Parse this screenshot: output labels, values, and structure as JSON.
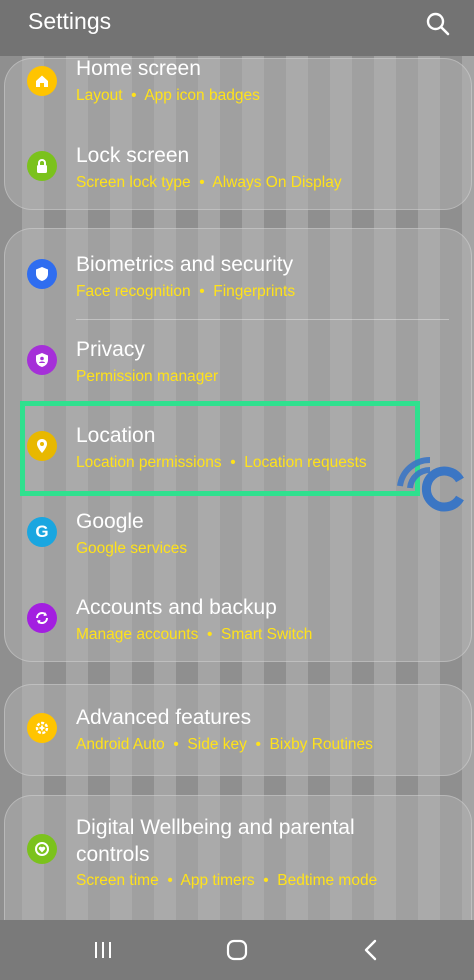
{
  "header": {
    "title": "Settings",
    "search_icon": "search-icon"
  },
  "colors": {
    "subtitle": "#ffe21a",
    "highlight": "#2fe08e"
  },
  "groups": [
    [
      {
        "label": "Home screen",
        "subs": [
          "Layout",
          "App icon badges"
        ],
        "icon": "home-icon",
        "color": "#ffc400"
      },
      {
        "label": "Lock screen",
        "subs": [
          "Screen lock type",
          "Always On Display"
        ],
        "icon": "lock-icon",
        "color": "#7bc21c"
      }
    ],
    [
      {
        "label": "Biometrics and security",
        "subs": [
          "Face recognition",
          "Fingerprints"
        ],
        "icon": "shield-icon",
        "color": "#2f6df0"
      },
      {
        "label": "Privacy",
        "subs": [
          "Permission manager"
        ],
        "icon": "privacy-icon",
        "color": "#a530d8"
      },
      {
        "label": "Location",
        "subs": [
          "Location permissions",
          "Location requests"
        ],
        "icon": "location-pin-icon",
        "color": "#e8b800"
      },
      {
        "label": "Google",
        "subs": [
          "Google services"
        ],
        "icon": "google-icon",
        "color": "#1aa6e0"
      },
      {
        "label": "Accounts and backup",
        "subs": [
          "Manage accounts",
          "Smart Switch"
        ],
        "icon": "sync-icon",
        "color": "#a31fe0"
      }
    ],
    [
      {
        "label": "Advanced features",
        "subs": [
          "Android Auto",
          "Side key",
          "Bixby Routines"
        ],
        "icon": "gear-plus-icon",
        "color": "#ffc400"
      }
    ],
    [
      {
        "label": "Digital Wellbeing and parental controls",
        "subs": [
          "Screen time",
          "App timers",
          "Bedtime mode"
        ],
        "icon": "wellbeing-icon",
        "color": "#7bc21c"
      }
    ]
  ],
  "navbar": {
    "icons": [
      "recent-apps-icon",
      "home-button-icon",
      "back-icon"
    ]
  }
}
